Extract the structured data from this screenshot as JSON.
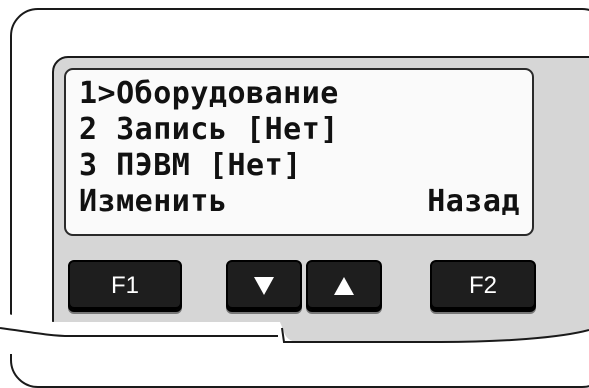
{
  "screen": {
    "line1": "1>Оборудование",
    "line2": "2 Запись [Нет]",
    "line3": "3 ПЭВМ [Нет]",
    "left_softkey": "Изменить",
    "right_softkey": "Назад"
  },
  "buttons": {
    "f1": "F1",
    "down_icon": "down-arrow",
    "up_icon": "up-arrow",
    "f2": "F2"
  },
  "colors": {
    "panel": "#d6d6d6",
    "screen": "#fafafa",
    "button": "#1e1e1e",
    "button_text": "#ffffff"
  }
}
